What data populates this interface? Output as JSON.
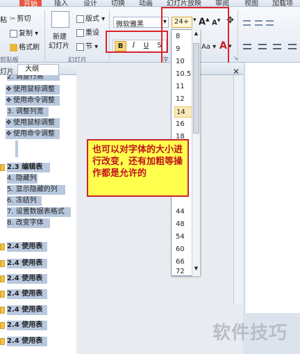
{
  "ribbon_tabs": [
    "开始",
    "插入",
    "设计",
    "切换",
    "动画",
    "幻灯片放映",
    "审阅",
    "视图",
    "加载项"
  ],
  "clipboard": {
    "cut": "剪切",
    "copy": "复制",
    "format_painter": "格式刷",
    "group": "剪贴板",
    "paste_partial": "粘"
  },
  "slides_group": {
    "new_slide": "新建",
    "new_slide2": "幻灯片",
    "layout": "版式",
    "reset": "重设",
    "section": "节",
    "group": "幻灯片"
  },
  "font": {
    "name": "微软雅黑",
    "size": "24+",
    "group_partial": "字",
    "bold": "B",
    "italic": "I",
    "underline": "U",
    "shadow": "S",
    "grow": "A",
    "shrink": "A",
    "change_case": "Aa"
  },
  "font_sizes": [
    "8",
    "9",
    "10",
    "10.5",
    "11",
    "12",
    "14",
    "16",
    "18",
    "44",
    "48",
    "54",
    "60",
    "66",
    "72"
  ],
  "selected_size": "14",
  "pane_tabs": {
    "slides_partial": "灯片",
    "outline": "大纲"
  },
  "outline_rows": [
    {
      "text": "2. 调整行高",
      "partial": true
    },
    {
      "text": "使用鼠标调整",
      "bullet": "❖"
    },
    {
      "text": "使用命令调整",
      "bullet": "❖"
    },
    {
      "text": "3. 调整列宽"
    },
    {
      "text": "使用鼠标调整",
      "bullet": "❖"
    },
    {
      "text": "使用命令调整",
      "bullet": "❖"
    }
  ],
  "outline_rows2": [
    {
      "text": "2.3 编辑表"
    },
    {
      "text": "4. 隐藏列"
    },
    {
      "text": "5. 显示隐藏的列"
    },
    {
      "text": "6. 冻结列"
    },
    {
      "text": "7. 设置数据表格式"
    },
    {
      "text": "8. 改变字体"
    }
  ],
  "slide_titles": [
    "2.4 使用表",
    "2.4 使用表",
    "2.4 使用表",
    "2.4 使用表",
    "2.4 使用表",
    "2.4 使用表",
    "2.4 使用表"
  ],
  "callout_text": "也可以对字体的大小进行改变，还有加粗等操作都是允许的",
  "watermark": "软件技巧",
  "colors": {
    "accent_red": "#d9242a",
    "highlight": "#b8c8de",
    "callout_bg": "#ffff4d"
  }
}
